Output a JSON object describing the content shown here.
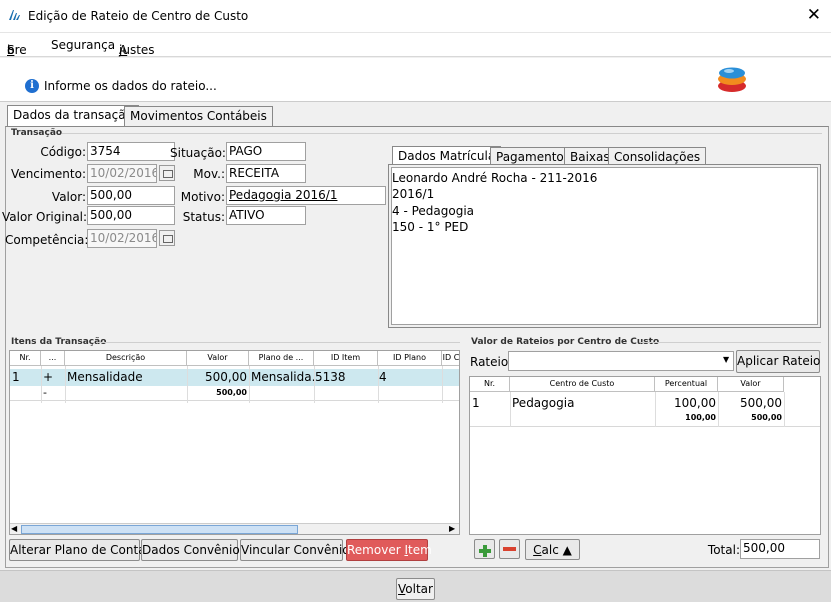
{
  "window": {
    "title": "Edição de Rateio de Centro de Custo",
    "close_glyph": "✕"
  },
  "menu": {
    "sobre": {
      "pre": "S",
      "u": "o",
      "post": "bre"
    },
    "seguranca": {
      "label": "Segurança"
    },
    "ajustes": {
      "u": "A",
      "post": "justes"
    }
  },
  "info": {
    "message": "Informe os dados do rateio..."
  },
  "tabs": {
    "dados": "Dados da transação",
    "movimentos": "Movimentos Contábeis"
  },
  "transacao": {
    "group": "Transação",
    "codigo_label": "Código:",
    "codigo": "3754",
    "vencimento_label": "Vencimento:",
    "vencimento": "10/02/2016",
    "valor_label": "Valor:",
    "valor": "500,00",
    "valor_original_label": "Valor Original:",
    "valor_original": "500,00",
    "competencia_label": "Competência:",
    "competencia": "10/02/2016",
    "situacao_label": "Situação:",
    "situacao": "PAGO",
    "mov_label": "Mov.:",
    "mov": "RECEITA",
    "motivo_label": "Motivo:",
    "motivo": "Pedagogia 2016/1",
    "status_label": "Status:",
    "status": "ATIVO"
  },
  "subtabs": {
    "matricula": "Dados Matrícula",
    "pagamentos": "Pagamentos",
    "baixas": "Baixas",
    "consolidacoes": "Consolidações"
  },
  "matricula": {
    "line1": "Leonardo André Rocha - 211-2016",
    "line2": "2016/1",
    "line3": "4 - Pedagogia",
    "line4": "150 - 1° PED"
  },
  "itens": {
    "group": "Itens da Transação",
    "headers": {
      "nr": "Nr.",
      "dots": "...",
      "descricao": "Descrição",
      "valor": "Valor",
      "plano": "Plano de ...",
      "id_item": "ID Item",
      "id_plano": "ID Plano",
      "id_c": "ID C"
    },
    "row": {
      "nr": "1",
      "op": "+",
      "descricao": "Mensalidade",
      "valor": "500,00",
      "plano": "Mensalida...",
      "id_item": "5138",
      "id_plano": "4"
    },
    "total_row": {
      "op": "-",
      "valor": "500,00"
    }
  },
  "rateios": {
    "group": "Valor de Rateios por Centro de Custo",
    "rateio_label": "Rateio:",
    "rateio_value": "",
    "aplicar": "Aplicar Rateio",
    "headers": {
      "nr": "Nr.",
      "centro": "Centro de Custo",
      "percentual": "Percentual",
      "valor": "Valor"
    },
    "row": {
      "nr": "1",
      "centro": "Pedagogia",
      "percentual": "100,00",
      "valor": "500,00"
    },
    "total_row": {
      "percentual": "100,00",
      "valor": "500,00"
    },
    "calc": {
      "u": "C",
      "post": "alc ▲"
    },
    "total_label": "Total:",
    "total": "500,00"
  },
  "buttons": {
    "alterar": "Alterar Plano de Conta",
    "convenio": "Dados Convênio",
    "vincular": "Vincular Convênio",
    "remover": {
      "pre": "Remover ",
      "u": "I",
      "post": "tem"
    },
    "voltar": {
      "u": "V",
      "post": "oltar"
    }
  },
  "colors": {
    "selected_row": "#cde8ef",
    "remove_button": "#e05b5b",
    "add_icon": "#3a9a3a",
    "remove_icon": "#d9422f",
    "info_icon": "#1f6fd0"
  }
}
